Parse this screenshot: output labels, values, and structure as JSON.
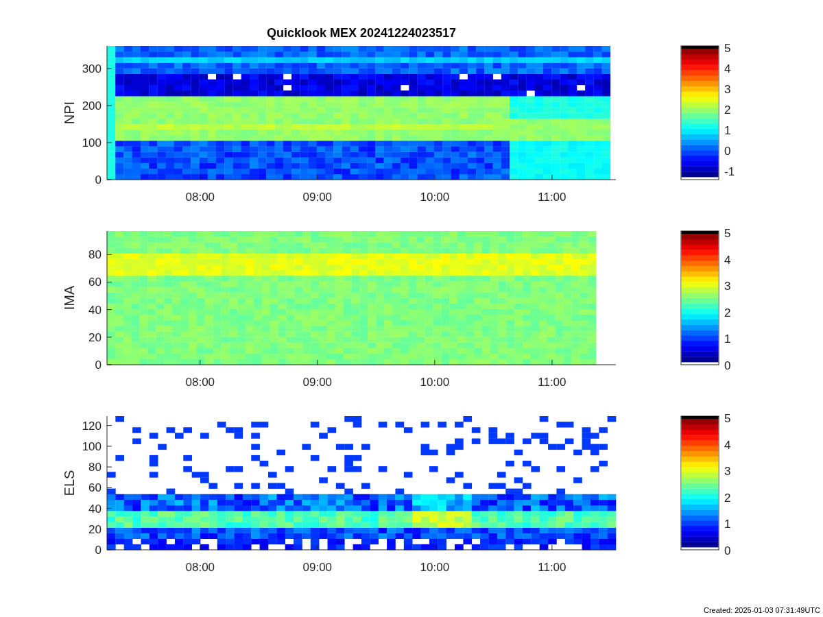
{
  "title": "Quicklook MEX 20241224023517",
  "panels": [
    {
      "kind": "npi",
      "ylabel": "NPI",
      "yticks": [
        "300",
        "200",
        "100",
        "0"
      ],
      "xticks": [
        "08:00",
        "09:00",
        "10:00",
        "11:00"
      ],
      "colorbar_ticks": [
        "5",
        "4",
        "3",
        "2",
        "1",
        "0",
        "-1"
      ]
    },
    {
      "kind": "ima",
      "ylabel": "IMA",
      "yticks": [
        "80",
        "60",
        "40",
        "20",
        "0"
      ],
      "xticks": [
        "08:00",
        "09:00",
        "10:00",
        "11:00"
      ],
      "colorbar_ticks": [
        "5",
        "4",
        "3",
        "2",
        "1",
        "0"
      ]
    },
    {
      "kind": "els",
      "ylabel": "ELS",
      "yticks": [
        "120",
        "100",
        "80",
        "60",
        "40",
        "20",
        "0"
      ],
      "xticks": [
        "08:00",
        "09:00",
        "10:00",
        "11:00"
      ],
      "colorbar_ticks": [
        "5",
        "4",
        "3",
        "2",
        "1",
        "0"
      ]
    }
  ],
  "footer": "Created: 2025-01-03 07:31:49UTC"
}
